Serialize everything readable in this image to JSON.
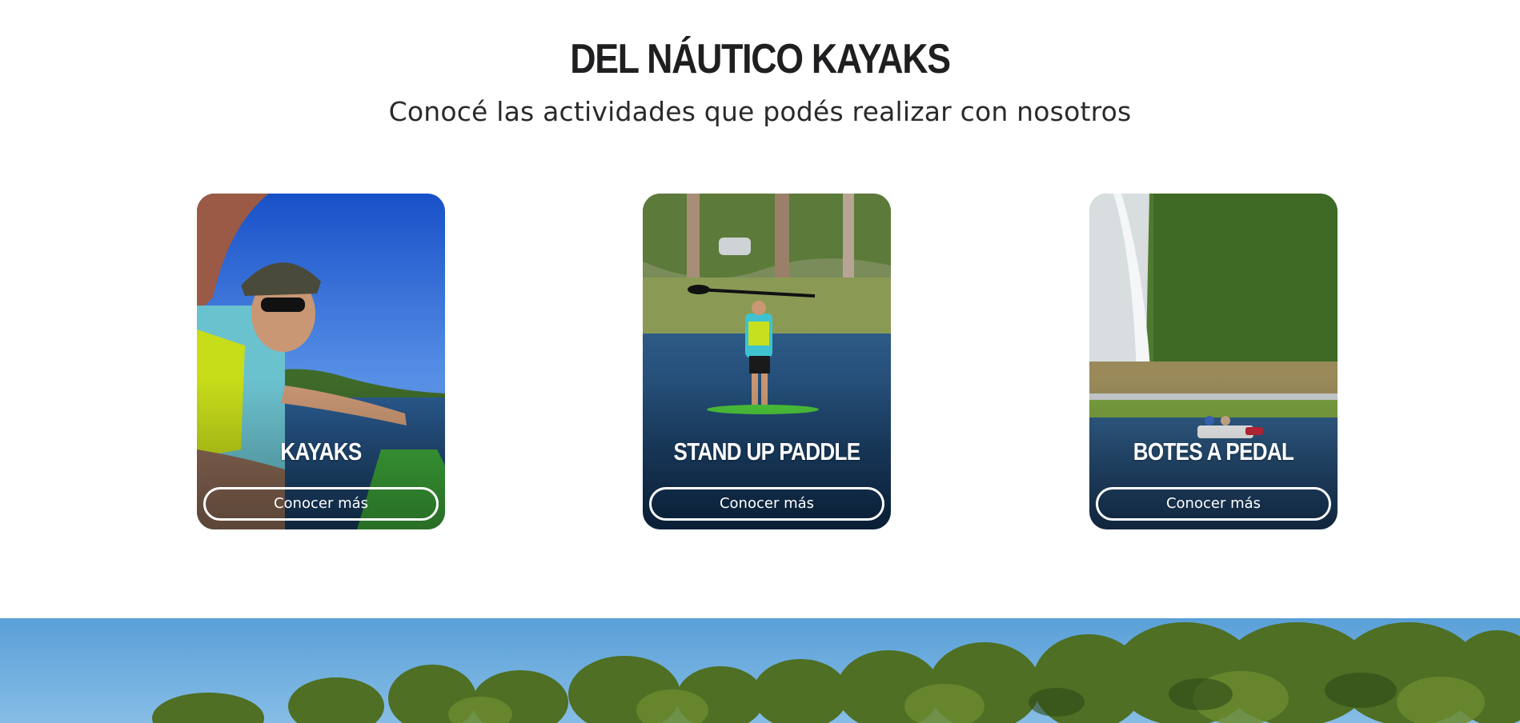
{
  "section": {
    "title": "DEL NÁUTICO KAYAKS",
    "subtitle": "Conocé las actividades que podés realizar con nosotros"
  },
  "cards": [
    {
      "title": "KAYAKS",
      "button_label": "Conocer más"
    },
    {
      "title": "STAND UP PADDLE",
      "button_label": "Conocer más"
    },
    {
      "title": "BOTES A PEDAL",
      "button_label": "Conocer más"
    }
  ],
  "colors": {
    "heading": "#1f1f21",
    "card_text": "#ffffff",
    "water": "#1e4a73",
    "sky": "#2f6fd0"
  }
}
